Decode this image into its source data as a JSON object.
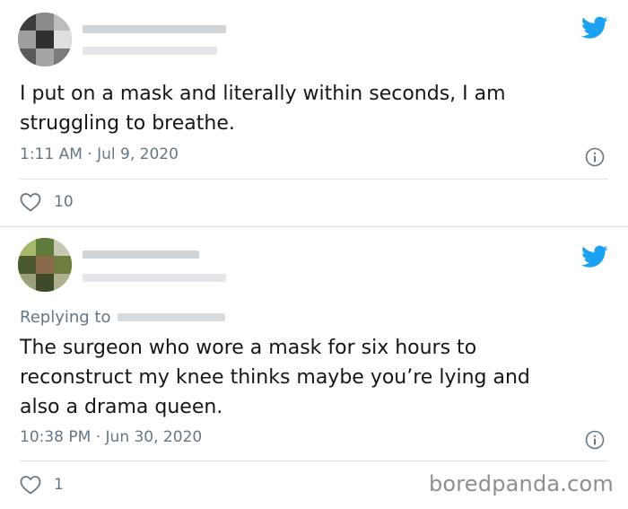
{
  "tweets": [
    {
      "text": "I put on a mask and literally within seconds, I am\nstruggling to breathe.",
      "timestamp": "1:11 AM · Jul 9, 2020",
      "likes": "10"
    },
    {
      "replying_to_label": "Replying to",
      "text": "The surgeon who wore a mask for six hours to\nreconstruct my knee thinks maybe you’re lying and\nalso a drama queen.",
      "timestamp": "10:38 PM · Jun 30, 2020",
      "likes": "1"
    }
  ],
  "icons": {
    "brand": "twitter-bird-icon",
    "info": "info-icon",
    "like": "heart-icon"
  },
  "colors": {
    "twitter_blue": "#1da1f2",
    "meta_gray": "#657786",
    "text": "#14171a"
  },
  "watermark": "boredpanda.com"
}
